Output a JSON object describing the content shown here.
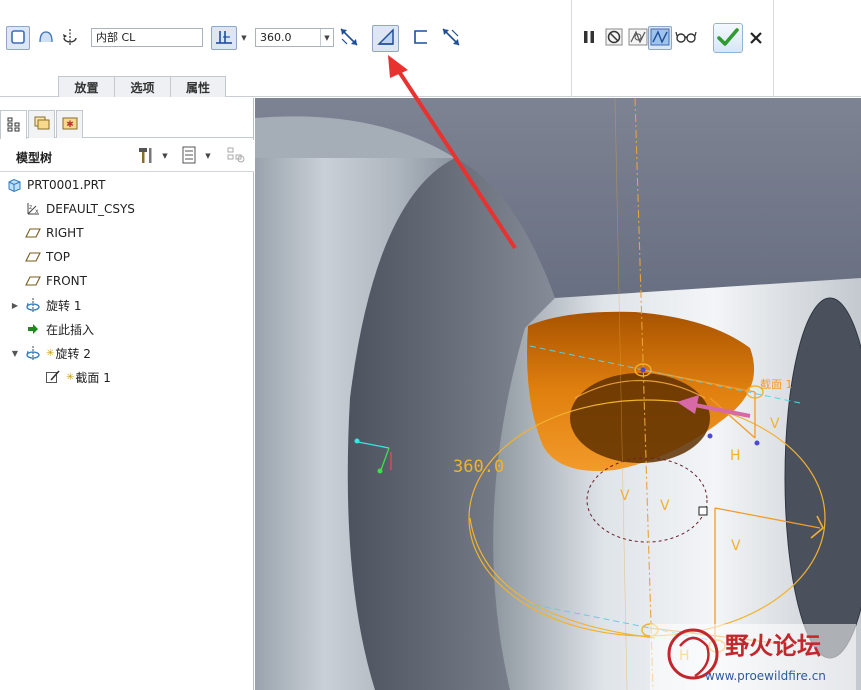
{
  "dashboard": {
    "tools": {
      "solid": "solid-icon",
      "surface": "surface-icon",
      "axis_pick": "axis-rotate-icon",
      "angle_type": "angle-from-sketch-icon",
      "flip_direction": "flip-direction-icon",
      "remove_material": "remove-material-icon",
      "thicken": "thicken-icon",
      "flip_material": "flip-material-side-icon"
    },
    "axis_field": {
      "value": "内部 CL"
    },
    "angle_combo": {
      "value": "360.0"
    },
    "tabs": [
      {
        "label": "放置"
      },
      {
        "label": "选项"
      },
      {
        "label": "属性"
      }
    ],
    "controls": {
      "pause": "pause-icon",
      "no_preview": "no-preview-icon",
      "attached_preview": "attached-preview-icon",
      "detached_preview": "detached-preview-icon",
      "verify": "verify-glasses-icon",
      "ok": "ok-checkmark-icon",
      "cancel": "cancel-x-icon"
    }
  },
  "panel": {
    "tabs": [
      "model-tree-icon",
      "folder-browser-icon",
      "favorites-icon"
    ],
    "title": "模型树",
    "tree": [
      {
        "label": "PRT0001.PRT",
        "icon": "part-icon"
      },
      {
        "label": "DEFAULT_CSYS",
        "icon": "csys-icon"
      },
      {
        "label": "RIGHT",
        "icon": "datum-plane-icon"
      },
      {
        "label": "TOP",
        "icon": "datum-plane-icon"
      },
      {
        "label": "FRONT",
        "icon": "datum-plane-icon"
      },
      {
        "label": "旋转 1",
        "icon": "revolve-icon"
      },
      {
        "label": "在此插入",
        "icon": "insert-here-arrow-icon"
      },
      {
        "label": "旋转 2",
        "icon": "revolve-icon"
      },
      {
        "label": "截面 1",
        "icon": "sketch-icon"
      }
    ]
  },
  "viewport": {
    "angle_dimension": "360.0",
    "section_label": "截面 1",
    "constraint_v": "V",
    "constraint_h": "H",
    "watermark": {
      "name": "野火论坛",
      "url": "www.proewildfire.cn"
    }
  },
  "colors": {
    "viewport_bg": "#6e7585",
    "cut_orange": "#e07d10",
    "sketch_yellow": "#f2b22e",
    "annotation_arrow": "#e8322f",
    "direction_arrow": "#d76aa6",
    "ok_green": "#2f9a2f"
  }
}
